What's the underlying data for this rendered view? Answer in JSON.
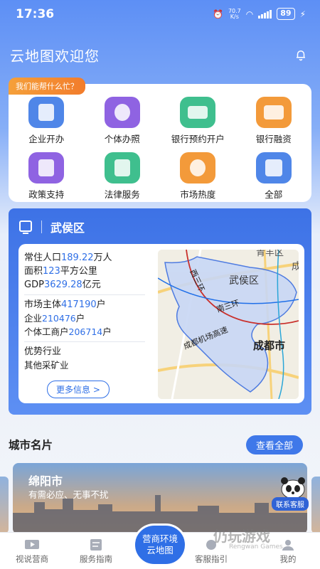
{
  "status_bar": {
    "time": "17:36",
    "speed_value": "70.7",
    "speed_unit": "K/s",
    "battery": "89"
  },
  "header": {
    "welcome": "云地图欢迎您"
  },
  "help": {
    "badge": "我们能帮什么忙？",
    "items": [
      {
        "label": "企业开办",
        "icon": "enterprise-icon",
        "color": "#4f86e8"
      },
      {
        "label": "个体办照",
        "icon": "individual-license-icon",
        "color": "#8f63e2"
      },
      {
        "label": "银行预约开户",
        "icon": "bank-card-icon",
        "color": "#3fbf8e"
      },
      {
        "label": "银行融资",
        "icon": "finance-icon",
        "color": "#f39a3a"
      },
      {
        "label": "政策支持",
        "icon": "policy-icon",
        "color": "#8f63e2"
      },
      {
        "label": "法律服务",
        "icon": "law-icon",
        "color": "#3fbf8e"
      },
      {
        "label": "市场热度",
        "icon": "hot-icon",
        "color": "#f39a3a"
      },
      {
        "label": "全部",
        "icon": "all-icon",
        "color": "#4f86e8"
      }
    ]
  },
  "district": {
    "name": "武侯区",
    "population_label": "常住人口",
    "population_value": "189.22",
    "population_unit": "万人",
    "area_label": "面积",
    "area_value": "123",
    "area_unit": "平方公里",
    "gdp_label": "GDP",
    "gdp_value": "3629.28",
    "gdp_unit": "亿元",
    "market_label": "市场主体",
    "market_value": "417190",
    "market_unit": "户",
    "enterprise_label": "企业",
    "enterprise_value": "210476",
    "enterprise_unit": "户",
    "individual_label": "个体工商户",
    "individual_value": "206714",
    "individual_unit": "户",
    "industry_label": "优势行业",
    "industry_value": "其他采矿业",
    "more_button": "更多信息 >",
    "map_labels": {
      "district": "武侯区",
      "city": "成都市",
      "ring": "西三环",
      "ring2": "南三环",
      "expressway": "成都机场高速",
      "top": "青羊区",
      "edge": "成"
    }
  },
  "city_cards": {
    "title": "城市名片",
    "view_all": "查看全部",
    "city_name": "绵阳市",
    "slogan": "有需必应、无事不扰",
    "customer_service": "联系客服"
  },
  "tabs": [
    {
      "label": "视说营商",
      "icon": "tv-icon"
    },
    {
      "label": "服务指南",
      "icon": "guide-icon"
    },
    {
      "label": "营商环境",
      "label2": "云地图",
      "icon": "center-map"
    },
    {
      "label": "客服指引",
      "icon": "service-icon"
    },
    {
      "label": "我的",
      "icon": "user-icon"
    }
  ],
  "watermark": {
    "text": "仍玩游戏",
    "sub": "Rengwan Games"
  }
}
